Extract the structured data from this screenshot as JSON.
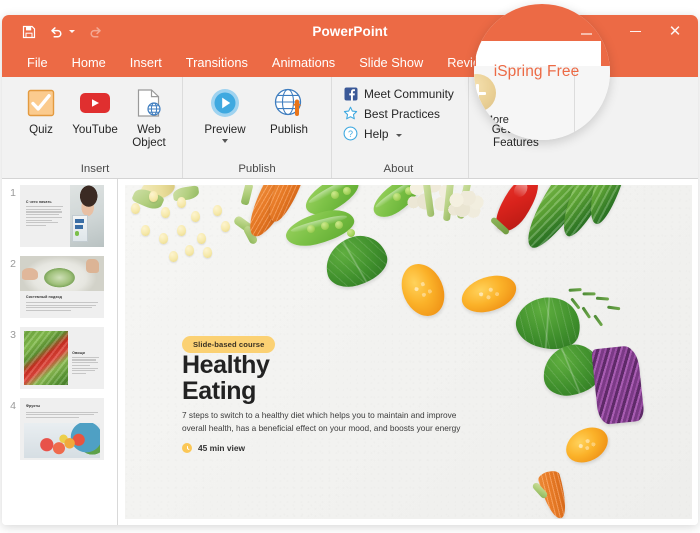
{
  "window": {
    "app_title": "PowerPoint",
    "quick_access": [
      {
        "name": "save",
        "icon": "save-icon",
        "enabled": true
      },
      {
        "name": "undo",
        "icon": "undo-icon",
        "enabled": true
      },
      {
        "name": "redo",
        "icon": "redo-icon",
        "enabled": false
      }
    ],
    "controls": [
      {
        "name": "minimize",
        "icon": "minimize-icon",
        "label": "—"
      },
      {
        "name": "close",
        "icon": "close-icon",
        "label": "×"
      }
    ]
  },
  "ribbon": {
    "tabs": [
      {
        "label": "File",
        "active": false
      },
      {
        "label": "Home",
        "active": false
      },
      {
        "label": "Insert",
        "active": false
      },
      {
        "label": "Transitions",
        "active": false
      },
      {
        "label": "Animations",
        "active": false
      },
      {
        "label": "Slide Show",
        "active": false
      },
      {
        "label": "Review",
        "active": false
      },
      {
        "label": "iSpring Free",
        "active": true
      }
    ],
    "groups": [
      {
        "label": "Insert",
        "buttons": [
          {
            "label": "Quiz",
            "icon": "quiz-checkbox-icon"
          },
          {
            "label": "YouTube",
            "icon": "youtube-icon"
          },
          {
            "label": "Web\nObject",
            "label_line1": "Web",
            "label_line2": "Object",
            "icon": "web-object-icon"
          }
        ]
      },
      {
        "label": "Publish",
        "buttons": [
          {
            "label": "Preview",
            "icon": "preview-play-icon",
            "has_dropdown": true
          },
          {
            "label": "Publish",
            "icon": "publish-globe-icon"
          }
        ]
      },
      {
        "label": "About",
        "items": [
          {
            "label": "Meet Community",
            "icon": "facebook-icon"
          },
          {
            "label": "Best Practices",
            "icon": "star-icon"
          },
          {
            "label": "Help",
            "icon": "help-question-icon",
            "has_dropdown": true
          }
        ]
      },
      {
        "label": "",
        "buttons": [
          {
            "label_line1": "Get More",
            "label_line2": "Features",
            "icon": "plus-circle-icon"
          }
        ]
      }
    ]
  },
  "thumbnails": [
    {
      "number": "1",
      "title": "С чего начать"
    },
    {
      "number": "2",
      "title": "Системный подход"
    },
    {
      "number": "3",
      "title": "Овощи"
    },
    {
      "number": "4",
      "title": "Фрукты"
    }
  ],
  "slide": {
    "badge": "Slide-based course",
    "title_line1": "Healthy",
    "title_line2": "Eating",
    "description": "7 steps to switch to a healthy diet which helps you to maintain and improve overall health, has a beneficial effect on your mood, and boosts your energy",
    "duration": "45 min view",
    "duration_icon": "clock-icon"
  },
  "spotlight": {
    "tab_label": "iSpring Free",
    "button_line1": "Get More",
    "button_line2": "Features",
    "plus_icon": "plus-circle-icon"
  },
  "colors": {
    "accent_orange": "#EC6A45",
    "ribbon_bg": "#F2F2F2",
    "badge_yellow": "#FBD173",
    "youtube_red": "#E02F2F"
  }
}
